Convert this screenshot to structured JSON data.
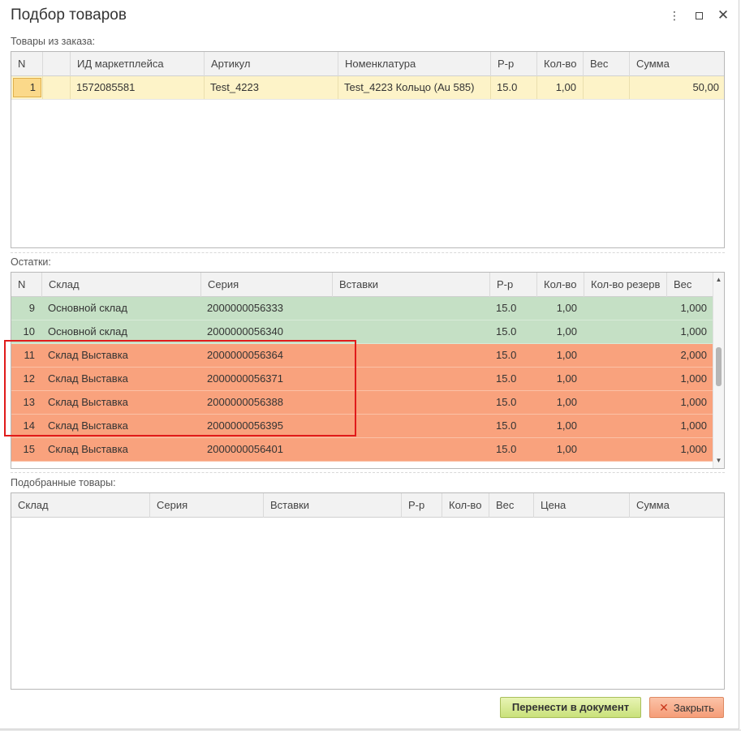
{
  "window": {
    "title": "Подбор товаров",
    "menu_icon": "more-vertical-icon",
    "maximize_icon": "maximize-icon",
    "close_icon": "close-icon"
  },
  "order_items": {
    "label": "Товары из заказа:",
    "columns": [
      "N",
      "",
      "ИД маркетплейса",
      "Артикул",
      "Номенклатура",
      "Р-р",
      "Кол-во",
      "Вес",
      "Сумма"
    ],
    "rows": [
      {
        "n": "1",
        "flag": "",
        "mp_id": "1572085581",
        "article": "Test_4223",
        "nomenclature": "Test_4223 Кольцо (Au 585)",
        "size": "15.0",
        "qty": "1,00",
        "weight": "",
        "sum": "50,00"
      }
    ]
  },
  "stock": {
    "label": "Остатки:",
    "columns": [
      "N",
      "Склад",
      "Серия",
      "Вставки",
      "Р-р",
      "Кол-во",
      "Кол-во резерв",
      "Вес"
    ],
    "rows": [
      {
        "n": "9",
        "warehouse": "Основной склад",
        "series": "2000000056333",
        "inserts": "",
        "size": "15.0",
        "qty": "1,00",
        "reserve": "",
        "weight": "1,000",
        "status": "green"
      },
      {
        "n": "10",
        "warehouse": "Основной склад",
        "series": "2000000056340",
        "inserts": "",
        "size": "15.0",
        "qty": "1,00",
        "reserve": "",
        "weight": "1,000",
        "status": "green"
      },
      {
        "n": "11",
        "warehouse": "Склад Выставка",
        "series": "2000000056364",
        "inserts": "",
        "size": "15.0",
        "qty": "1,00",
        "reserve": "",
        "weight": "2,000",
        "status": "orange"
      },
      {
        "n": "12",
        "warehouse": "Склад Выставка",
        "series": "2000000056371",
        "inserts": "",
        "size": "15.0",
        "qty": "1,00",
        "reserve": "",
        "weight": "1,000",
        "status": "orange"
      },
      {
        "n": "13",
        "warehouse": "Склад Выставка",
        "series": "2000000056388",
        "inserts": "",
        "size": "15.0",
        "qty": "1,00",
        "reserve": "",
        "weight": "1,000",
        "status": "orange"
      },
      {
        "n": "14",
        "warehouse": "Склад Выставка",
        "series": "2000000056395",
        "inserts": "",
        "size": "15.0",
        "qty": "1,00",
        "reserve": "",
        "weight": "1,000",
        "status": "orange"
      },
      {
        "n": "15",
        "warehouse": "Склад Выставка",
        "series": "2000000056401",
        "inserts": "",
        "size": "15.0",
        "qty": "1,00",
        "reserve": "",
        "weight": "1,000",
        "status": "orange"
      }
    ]
  },
  "selected": {
    "label": "Подобранные товары:",
    "columns": [
      "Склад",
      "Серия",
      "Вставки",
      "Р-р",
      "Кол-во",
      "Вес",
      "Цена",
      "Сумма"
    ]
  },
  "buttons": {
    "transfer": "Перенести в документ",
    "close": "Закрыть"
  },
  "colors": {
    "green_row": "#c5e0c5",
    "orange_row": "#f9a27d",
    "selected_row": "#fdf3c8",
    "highlight_border": "#e01b1b"
  }
}
